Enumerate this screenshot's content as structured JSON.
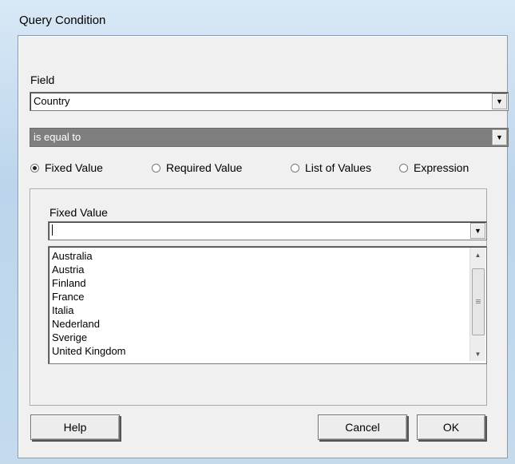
{
  "window": {
    "title": "Query Condition"
  },
  "field": {
    "label": "Field",
    "value": "Country"
  },
  "operator": {
    "value": "is equal to"
  },
  "value_type": {
    "options": [
      "Fixed Value",
      "Required Value",
      "List of Values",
      "Expression"
    ],
    "selected": "Fixed Value"
  },
  "fixed_value": {
    "label": "Fixed Value",
    "input_value": "",
    "list": [
      "Australia",
      "Austria",
      "Finland",
      "France",
      "Italia",
      "Nederland",
      "Sverige",
      "United Kingdom"
    ]
  },
  "buttons": {
    "help": "Help",
    "cancel": "Cancel",
    "ok": "OK"
  }
}
